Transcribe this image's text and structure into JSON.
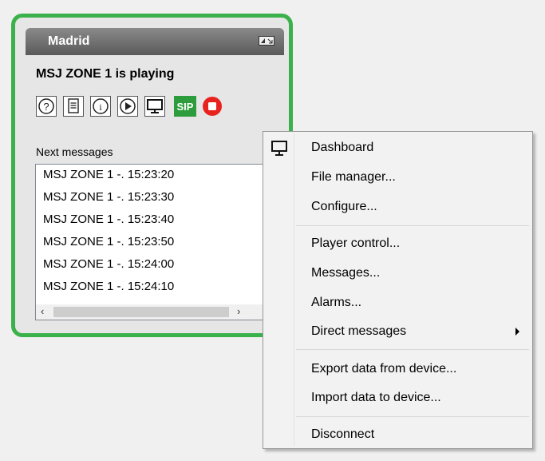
{
  "widget": {
    "title": "Madrid",
    "status": "MSJ ZONE 1 is playing",
    "sip_label": "SIP",
    "icons": [
      "help-icon",
      "document-icon",
      "info-icon",
      "play-icon",
      "monitor-icon",
      "sip-icon",
      "stop-icon"
    ],
    "next_messages_label": "Next messages",
    "next_messages": [
      "MSJ ZONE 1 -. 15:23:20",
      "MSJ ZONE 1 -. 15:23:30",
      "MSJ ZONE 1 -. 15:23:40",
      "MSJ ZONE 1 -. 15:23:50",
      "MSJ ZONE 1 -. 15:24:00",
      "MSJ ZONE 1 -. 15:24:10"
    ]
  },
  "context_menu": {
    "items": [
      {
        "label": "Dashboard",
        "icon": "monitor-icon"
      },
      {
        "label": "File manager..."
      },
      {
        "label": "Configure..."
      },
      {
        "label": "Player control..."
      },
      {
        "label": "Messages..."
      },
      {
        "label": "Alarms..."
      },
      {
        "label": "Direct messages",
        "submenu": true
      },
      {
        "label": "Export data from device..."
      },
      {
        "label": "Import data to device..."
      },
      {
        "label": "Disconnect"
      }
    ]
  },
  "colors": {
    "card_border": "#3ab14a",
    "sip_bg": "#2c9c3c",
    "stop_red": "#e8231f",
    "titlebar": "#6e6e6e"
  }
}
